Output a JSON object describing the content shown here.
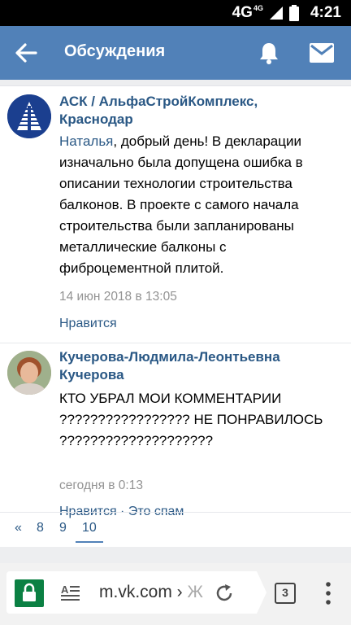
{
  "status_bar": {
    "network": "4G",
    "network_sub": "4G",
    "time": "4:21"
  },
  "header": {
    "title": "Обсуждения",
    "back_icon": "arrow-left-icon",
    "bell_icon": "bell-icon",
    "mail_icon": "envelope-icon",
    "color": "#5181b8"
  },
  "comments": [
    {
      "author_line1": "АСК / АльфаСтройКомплекс,",
      "author_line2": "Краснодар",
      "reply_to": "Наталья",
      "text_lines": [
        ", добрый день! В декларации",
        "изначально была допущена ошибка в",
        "описании технологии строительства",
        "балконов. В проекте с самого начала",
        "строительства были запланированы",
        "металлические балконы с",
        "фиброцементной плитой."
      ],
      "date": "14 июн 2018 в 13:05",
      "like_label": "Нравится"
    },
    {
      "author_line1": "Кучерова-Людмила-Леонтьевна",
      "author_line2": "Кучерова",
      "text_lines": [
        "КТО УБРАЛ МОИ КОММЕНТАРИИ",
        "????????????????? НЕ ПОНРАВИЛОСЬ",
        "????????????????????"
      ],
      "date": "сегодня в 0:13",
      "like_label": "Нравится",
      "separator": " · ",
      "spam_label": "Это спам"
    }
  ],
  "pagination": {
    "prev": "«",
    "pages": [
      "8",
      "9",
      "10"
    ],
    "active": "10"
  },
  "browser": {
    "url": "m.vk.com › ",
    "url_truncated": "Ж",
    "tab_count": "3",
    "secure_color": "#0b8043"
  }
}
